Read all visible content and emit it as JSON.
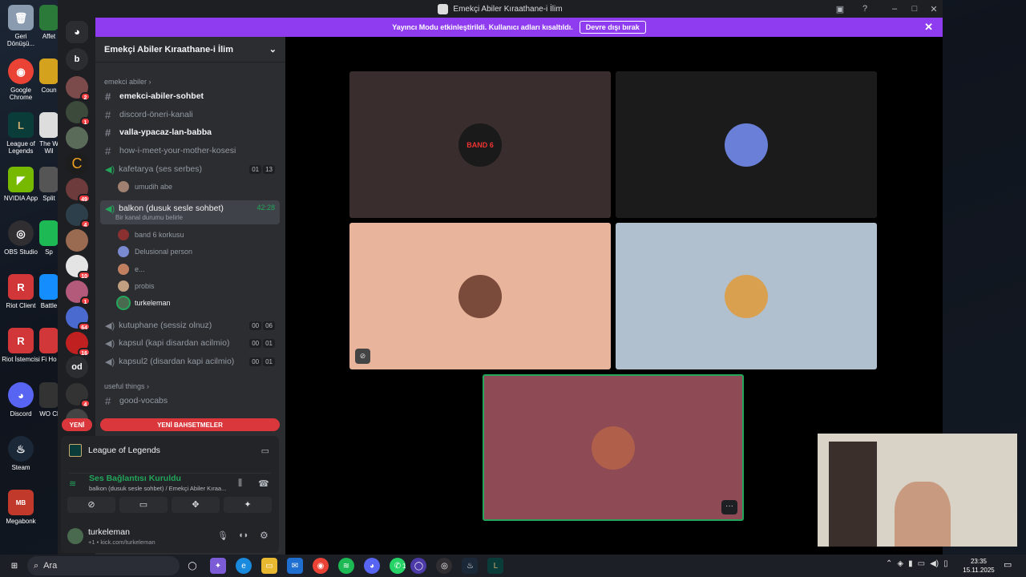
{
  "window": {
    "title": "Emekçi Abiler Kıraathane-i İlim"
  },
  "streamer": {
    "text": "Yayıncı Modu etkinleştirildi. Kullanıcı adları kısaltıldı.",
    "button": "Devre dışı bırak"
  },
  "server": {
    "name": "Emekçi Abiler Kıraathane-i İlim"
  },
  "guild_letters": {
    "b": "b",
    "od": "od"
  },
  "guild_badges": [
    "2",
    "1",
    "49",
    "4",
    "10",
    "1",
    "64",
    "16",
    "4"
  ],
  "categories": {
    "cat1": "emekci abiler",
    "cat2": "useful things"
  },
  "channels": {
    "c1": "emekci-abiler-sohbet",
    "c2": "discord-öneri-kanali",
    "c3": "valla-ypacaz-lan-babba",
    "c4": "how-i-meet-your-mother-kosesi",
    "v1": "kafetarya (ses serbes)",
    "v1a": "01",
    "v1b": "13",
    "v2": "balkon (dusuk sesle sohbet)",
    "v2time": "42:28",
    "v2status": "Bir kanal durumu belirle",
    "v3": "kutuphane (sessiz olnuz)",
    "v3a": "00",
    "v3b": "06",
    "v4": "kapsul (kapi disardan acilmio)",
    "v4a": "00",
    "v4b": "01",
    "v5": "kapsul2 (disardan kapi acilmio)",
    "v5a": "00",
    "v5b": "01",
    "c5": "good-vocabs"
  },
  "members": {
    "m0": "umudih abe",
    "m1": "band 6 korkusu",
    "m2": "Delusional person",
    "m3": "e...",
    "m4": "probis",
    "m5": "turkeleman"
  },
  "newbar": {
    "left": "YENİ",
    "right": "YENİ BAHSETMELER"
  },
  "panel": {
    "activity": "League of Legends",
    "voice_status": "Ses Bağlantısı Kuruldu",
    "voice_channel": "balkon (dusuk sesle sohbet) / Emekçi Abiler Kıraa...",
    "user": "turkeleman",
    "user_status": "kick.com/turkeleman",
    "user_status_prefix": "+1 •"
  },
  "tiles": {
    "t1_avatar_text": "BAND 6"
  },
  "desktop_icons": [
    "Geri Dönüşü...",
    "Google Chrome",
    "League of Legends",
    "NVIDIA App",
    "OBS Studio",
    "Riot Client",
    "Riot İstemcisi",
    "Discord",
    "Steam",
    "Megabonk"
  ],
  "desktop_icons2": [
    "Affet",
    "Coun",
    "The W Wil",
    "Split",
    "Sp",
    "Battle",
    "Fi Ho",
    "WO Cl"
  ],
  "taskbar": {
    "search": "Ara",
    "time": "23:35",
    "date": "15.11.2025",
    "wa_badge": "1"
  },
  "colors": {
    "accent": "#8f3cf0",
    "green": "#23a55a",
    "red": "#da373c"
  }
}
